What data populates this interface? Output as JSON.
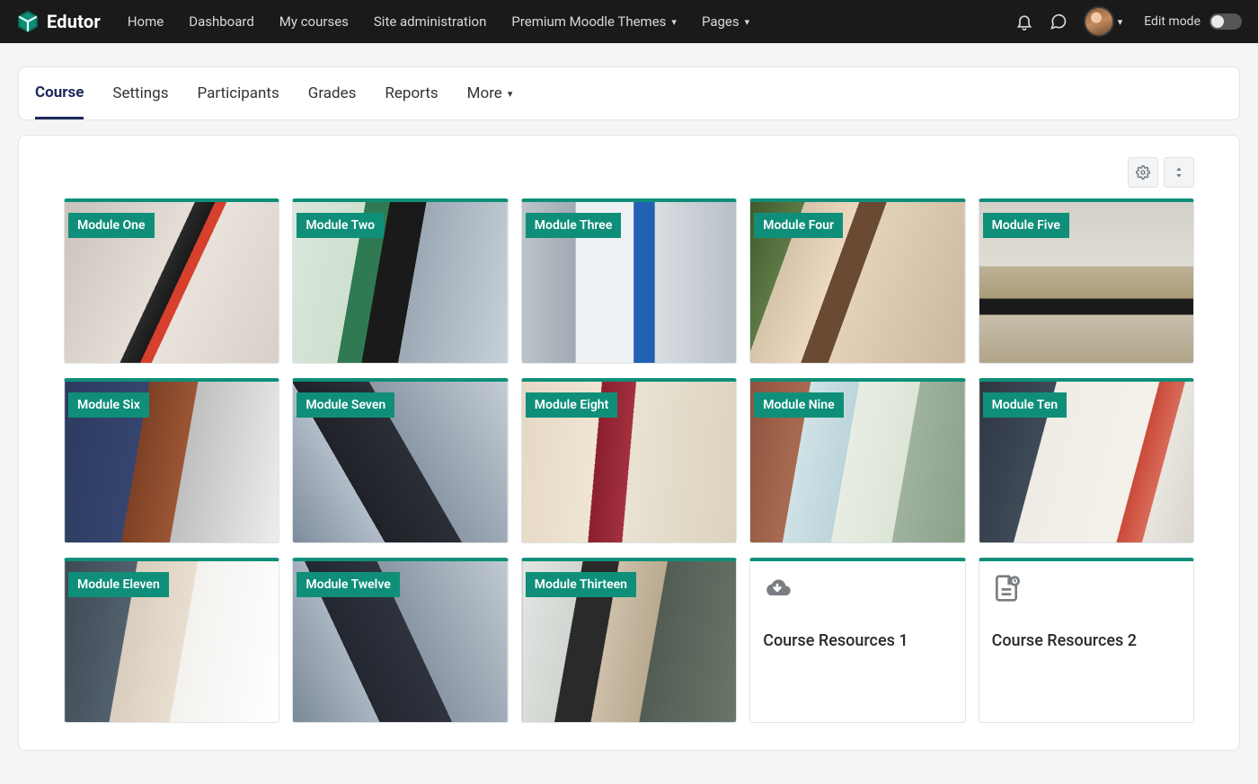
{
  "brand": {
    "name": "Edutor"
  },
  "nav": {
    "items": [
      {
        "label": "Home",
        "has_chevron": false
      },
      {
        "label": "Dashboard",
        "has_chevron": false
      },
      {
        "label": "My courses",
        "has_chevron": false
      },
      {
        "label": "Site administration",
        "has_chevron": false
      },
      {
        "label": "Premium Moodle Themes",
        "has_chevron": true
      },
      {
        "label": "Pages",
        "has_chevron": true
      }
    ],
    "edit_mode_label": "Edit mode"
  },
  "tabs": {
    "items": [
      {
        "label": "Course",
        "active": true,
        "has_chevron": false
      },
      {
        "label": "Settings",
        "active": false,
        "has_chevron": false
      },
      {
        "label": "Participants",
        "active": false,
        "has_chevron": false
      },
      {
        "label": "Grades",
        "active": false,
        "has_chevron": false
      },
      {
        "label": "Reports",
        "active": false,
        "has_chevron": false
      },
      {
        "label": "More",
        "active": false,
        "has_chevron": true
      }
    ]
  },
  "tiles": [
    {
      "kind": "module",
      "label": "Module One",
      "bg": "bg-m1"
    },
    {
      "kind": "module",
      "label": "Module Two",
      "bg": "bg-m2"
    },
    {
      "kind": "module",
      "label": "Module Three",
      "bg": "bg-m3"
    },
    {
      "kind": "module",
      "label": "Module Four",
      "bg": "bg-m4"
    },
    {
      "kind": "module",
      "label": "Module Five",
      "bg": "bg-m5"
    },
    {
      "kind": "module",
      "label": "Module Six",
      "bg": "bg-m6"
    },
    {
      "kind": "module",
      "label": "Module Seven",
      "bg": "bg-m7"
    },
    {
      "kind": "module",
      "label": "Module Eight",
      "bg": "bg-m8"
    },
    {
      "kind": "module",
      "label": "Module Nine",
      "bg": "bg-m9"
    },
    {
      "kind": "module",
      "label": "Module Ten",
      "bg": "bg-m10"
    },
    {
      "kind": "module",
      "label": "Module Eleven",
      "bg": "bg-m11"
    },
    {
      "kind": "module",
      "label": "Module Twelve",
      "bg": "bg-m12"
    },
    {
      "kind": "module",
      "label": "Module Thirteen",
      "bg": "bg-m13"
    },
    {
      "kind": "resource",
      "label": "Course Resources 1",
      "icon": "download"
    },
    {
      "kind": "resource",
      "label": "Course Resources 2",
      "icon": "file"
    }
  ]
}
